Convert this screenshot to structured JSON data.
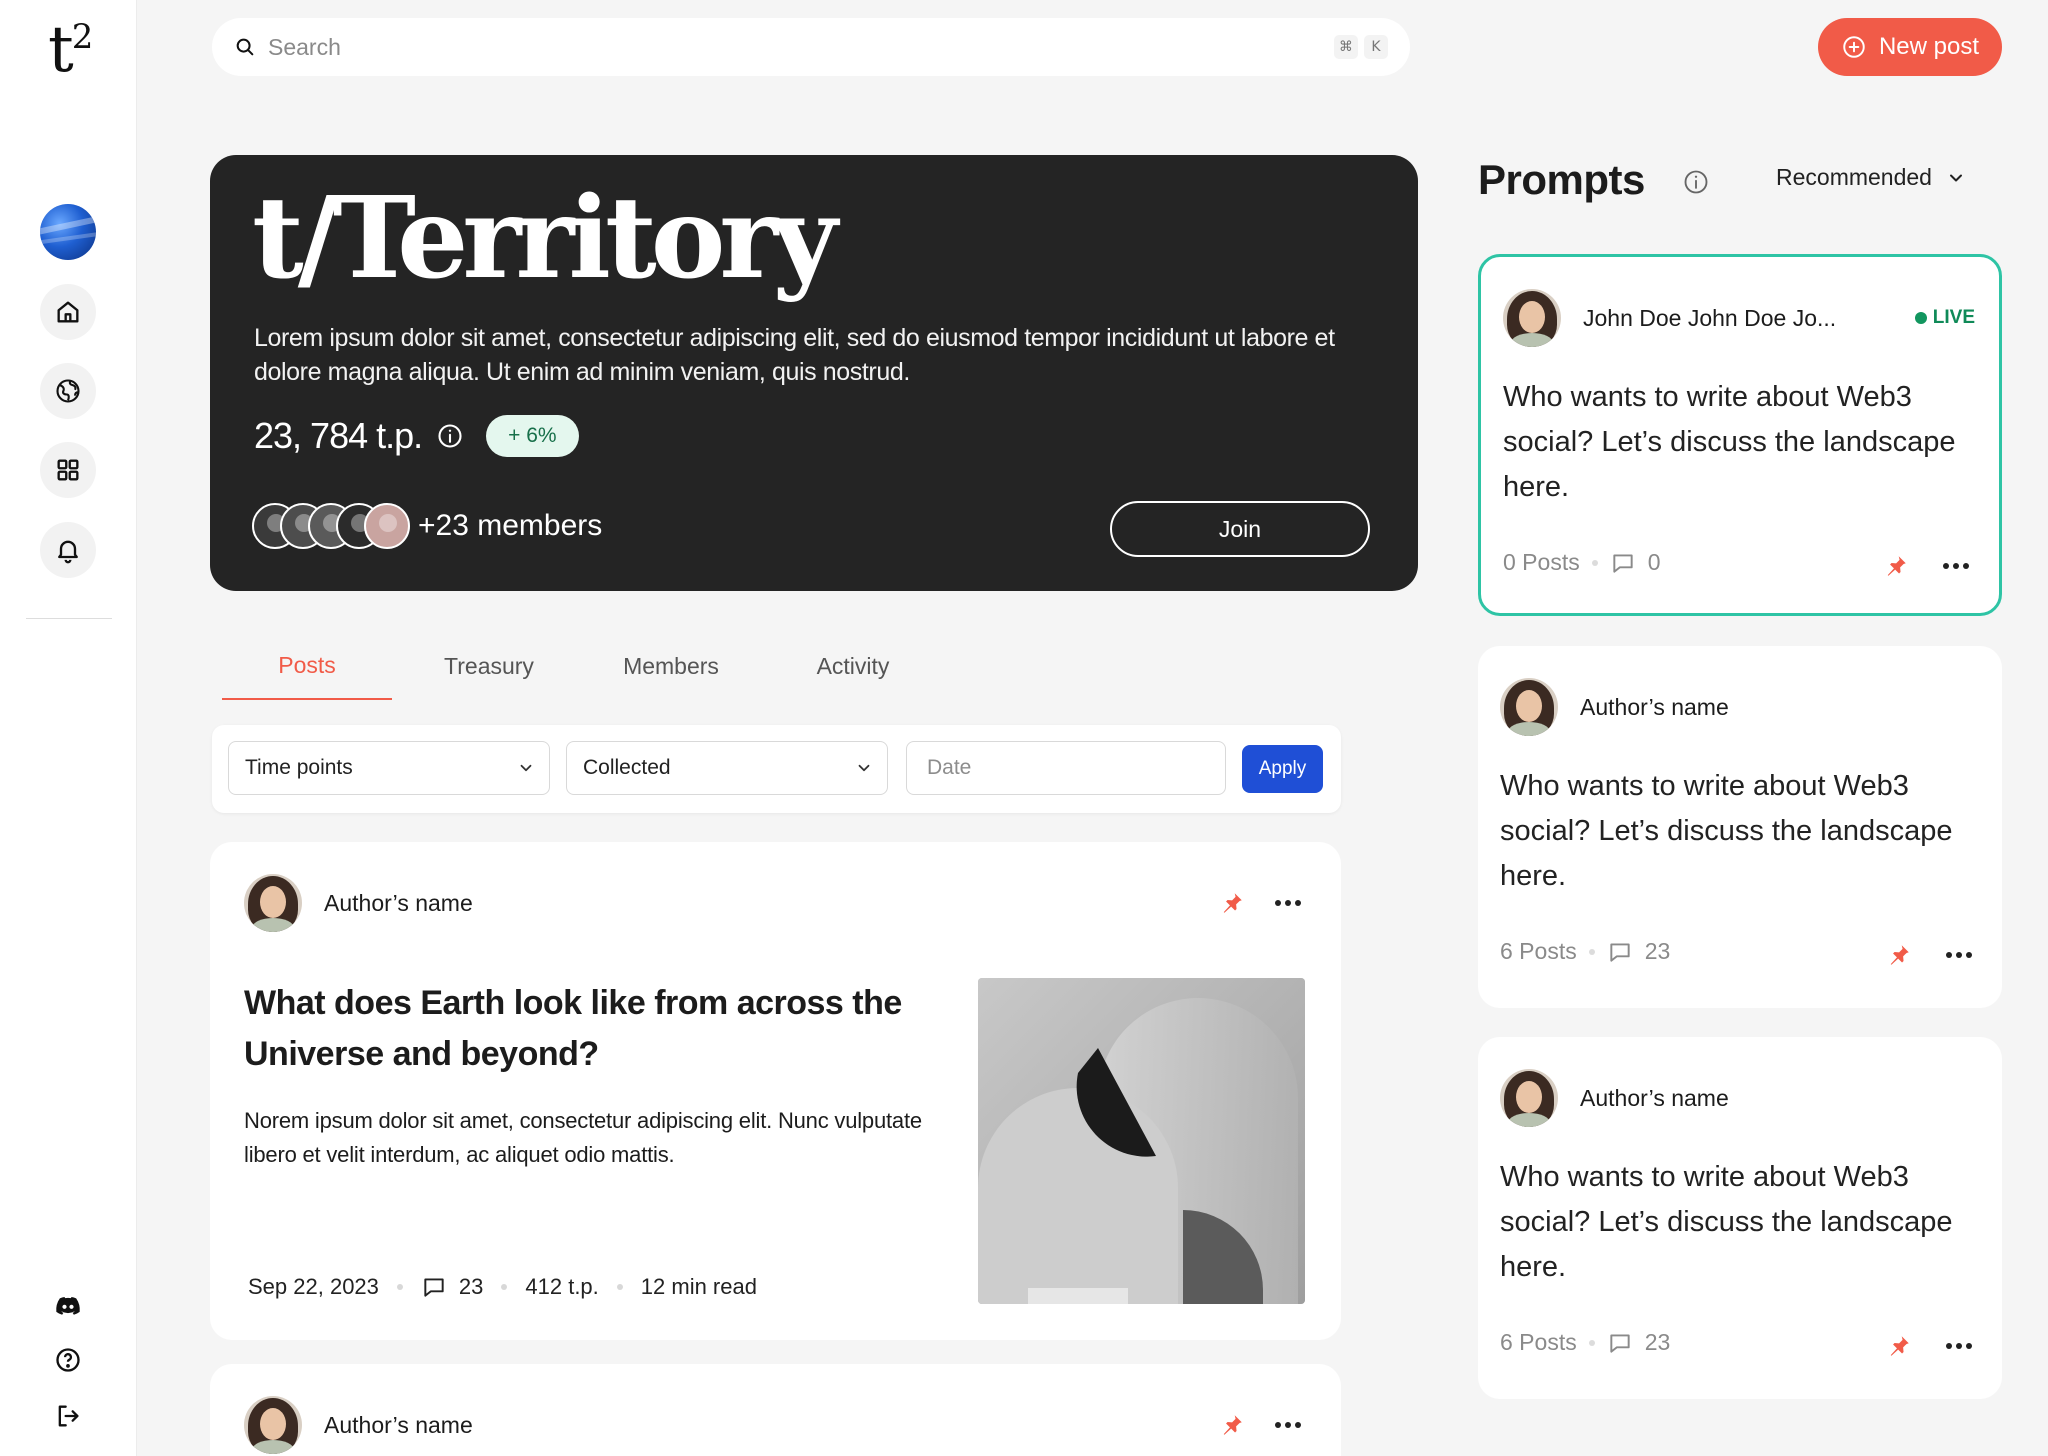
{
  "app": {
    "logo": "t",
    "logo_sup": "2"
  },
  "search": {
    "placeholder": "Search",
    "shortcut_cmd": "⌘",
    "shortcut_key": "K"
  },
  "new_post": {
    "label": "New post"
  },
  "sidebar": {
    "items": [
      {
        "icon": "home-icon"
      },
      {
        "icon": "globe-icon"
      },
      {
        "icon": "grid-icon"
      },
      {
        "icon": "bell-icon"
      }
    ],
    "bottom": [
      {
        "icon": "discord-icon"
      },
      {
        "icon": "help-icon"
      },
      {
        "icon": "logout-icon"
      }
    ]
  },
  "hero": {
    "title": "t/Territory",
    "description": "Lorem ipsum dolor sit amet, consectetur adipiscing elit, sed do eiusmod tempor incididunt ut labore et dolore magna aliqua. Ut enim ad minim veniam, quis nostrud.",
    "tp_value": "23, 784 t.p.",
    "change_badge": "+ 6%",
    "members_text": "+23 members",
    "join_label": "Join",
    "member_avatar_colors": [
      "#3a3a3a",
      "#4d4d4d",
      "#5a5a5a",
      "#2b2b2b",
      "#c9a4a0"
    ]
  },
  "tabs": [
    {
      "label": "Posts",
      "active": true
    },
    {
      "label": "Treasury",
      "active": false
    },
    {
      "label": "Members",
      "active": false
    },
    {
      "label": "Activity",
      "active": false
    }
  ],
  "filters": {
    "select1": "Time points",
    "select2": "Collected",
    "date_placeholder": "Date",
    "apply_label": "Apply"
  },
  "posts": [
    {
      "author": "Author’s name",
      "title": "What does Earth look like from across the Universe and beyond?",
      "body": "Norem ipsum dolor sit amet, consectetur adipiscing elit. Nunc vulputate libero et velit interdum, ac aliquet odio mattis.",
      "date": "Sep 22, 2023",
      "comments": "23",
      "tp": "412 t.p.",
      "read_time": "12 min read"
    },
    {
      "author": "Author’s name"
    }
  ],
  "prompts": {
    "title": "Prompts",
    "sort_label": "Recommended",
    "items": [
      {
        "author": "John Doe John Doe Jo...",
        "live_label": "LIVE",
        "text": "Who wants to write about Web3 social? Let’s discuss the landscape here.",
        "posts": "0 Posts",
        "comments": "0"
      },
      {
        "author": "Author’s name",
        "text": "Who wants to write about Web3 social? Let’s discuss the landscape here.",
        "posts": "6 Posts",
        "comments": "23"
      },
      {
        "author": "Author’s name",
        "text": "Who wants to write about Web3 social? Let’s discuss the landscape here.",
        "posts": "6 Posts",
        "comments": "23"
      }
    ]
  },
  "colors": {
    "accent": "#f15b48",
    "primary_button": "#1f4fd6",
    "live": "#12965f",
    "live_border": "#2ec4a5",
    "hero_bg": "#242424"
  }
}
